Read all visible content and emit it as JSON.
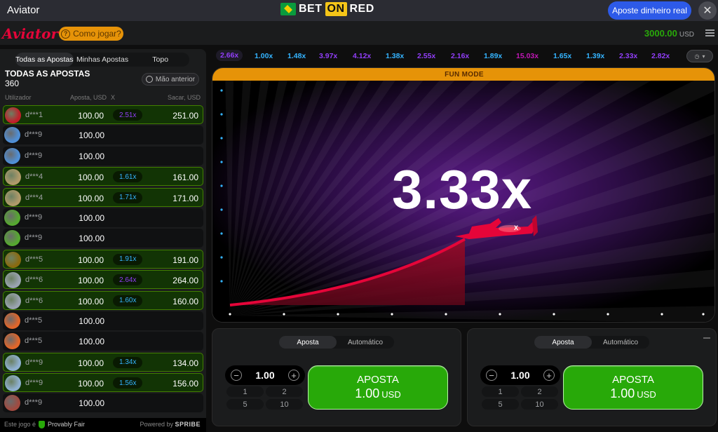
{
  "topbar": {
    "title": "Aviator",
    "brand": {
      "part1": "BET",
      "part2": "ON",
      "part3": "RED"
    },
    "real_money_label": "Aposte dinheiro real",
    "close_label": "✕"
  },
  "gamebar": {
    "logo": "Aviator",
    "how_to_play": "Como jogar?",
    "balance": "3000.00",
    "currency": "USD"
  },
  "bets_panel": {
    "tabs": [
      "Todas as Apostas",
      "Minhas Apostas",
      "Topo"
    ],
    "title": "TODAS AS APOSTAS",
    "count": "360",
    "previous_button": "Mão anterior",
    "columns": {
      "user": "Utilizador",
      "bet": "Aposta, USD",
      "x": "X",
      "cashout": "Sacar, USD"
    },
    "rows": [
      {
        "user": "d***1",
        "bet": "100.00",
        "mult": "2.51x",
        "cashout": "251.00",
        "win": true,
        "mult_color": "#913ef8",
        "avatar": "#c0202a"
      },
      {
        "user": "d***9",
        "bet": "100.00",
        "mult": "",
        "cashout": "",
        "win": false,
        "mult_color": "",
        "avatar": "#4f8fd6"
      },
      {
        "user": "d***9",
        "bet": "100.00",
        "mult": "",
        "cashout": "",
        "win": false,
        "mult_color": "",
        "avatar": "#4f8fd6"
      },
      {
        "user": "d***4",
        "bet": "100.00",
        "mult": "1.61x",
        "cashout": "161.00",
        "win": true,
        "mult_color": "#34b4ff",
        "avatar": "#b09a6a"
      },
      {
        "user": "d***4",
        "bet": "100.00",
        "mult": "1.71x",
        "cashout": "171.00",
        "win": true,
        "mult_color": "#34b4ff",
        "avatar": "#b09a6a"
      },
      {
        "user": "d***9",
        "bet": "100.00",
        "mult": "",
        "cashout": "",
        "win": false,
        "mult_color": "",
        "avatar": "#56a830"
      },
      {
        "user": "d***9",
        "bet": "100.00",
        "mult": "",
        "cashout": "",
        "win": false,
        "mult_color": "",
        "avatar": "#56a830"
      },
      {
        "user": "d***5",
        "bet": "100.00",
        "mult": "1.91x",
        "cashout": "191.00",
        "win": true,
        "mult_color": "#34b4ff",
        "avatar": "#8a6a10"
      },
      {
        "user": "d***6",
        "bet": "100.00",
        "mult": "2.64x",
        "cashout": "264.00",
        "win": true,
        "mult_color": "#913ef8",
        "avatar": "#9aa3b0"
      },
      {
        "user": "d***6",
        "bet": "100.00",
        "mult": "1.60x",
        "cashout": "160.00",
        "win": true,
        "mult_color": "#34b4ff",
        "avatar": "#9aa3b0"
      },
      {
        "user": "d***5",
        "bet": "100.00",
        "mult": "",
        "cashout": "",
        "win": false,
        "mult_color": "",
        "avatar": "#e0662a"
      },
      {
        "user": "d***5",
        "bet": "100.00",
        "mult": "",
        "cashout": "",
        "win": false,
        "mult_color": "",
        "avatar": "#e0662a"
      },
      {
        "user": "d***9",
        "bet": "100.00",
        "mult": "1.34x",
        "cashout": "134.00",
        "win": true,
        "mult_color": "#34b4ff",
        "avatar": "#8fb0d0"
      },
      {
        "user": "d***9",
        "bet": "100.00",
        "mult": "1.56x",
        "cashout": "156.00",
        "win": true,
        "mult_color": "#34b4ff",
        "avatar": "#8fb0d0"
      },
      {
        "user": "d***9",
        "bet": "100.00",
        "mult": "",
        "cashout": "",
        "win": false,
        "mult_color": "",
        "avatar": "#a04a40"
      }
    ]
  },
  "footer": {
    "provably_prefix": "Este jogo é",
    "provably_fair": "Provably Fair",
    "powered_by": "Powered by",
    "spribe": "SPRIBE"
  },
  "history": [
    {
      "value": "2.66x",
      "color": "#913ef8"
    },
    {
      "value": "1.00x",
      "color": "#34b4ff"
    },
    {
      "value": "1.48x",
      "color": "#34b4ff"
    },
    {
      "value": "3.97x",
      "color": "#913ef8"
    },
    {
      "value": "4.12x",
      "color": "#913ef8"
    },
    {
      "value": "1.38x",
      "color": "#34b4ff"
    },
    {
      "value": "2.55x",
      "color": "#913ef8"
    },
    {
      "value": "2.16x",
      "color": "#913ef8"
    },
    {
      "value": "1.89x",
      "color": "#34b4ff"
    },
    {
      "value": "15.03x",
      "color": "#c017b4"
    },
    {
      "value": "1.65x",
      "color": "#34b4ff"
    },
    {
      "value": "1.39x",
      "color": "#34b4ff"
    },
    {
      "value": "2.33x",
      "color": "#913ef8"
    },
    {
      "value": "2.82x",
      "color": "#913ef8"
    }
  ],
  "stage": {
    "fun_mode": "FUN MODE",
    "multiplier": "3.33x",
    "accent": "#e50539"
  },
  "bet_panels": [
    {
      "tabs": [
        "Aposta",
        "Automático"
      ],
      "amount": "1.00",
      "quick": [
        "1",
        "2",
        "5",
        "10"
      ],
      "button_label": "APOSTA",
      "button_amount": "1.00",
      "button_currency": "USD"
    },
    {
      "tabs": [
        "Aposta",
        "Automático"
      ],
      "amount": "1.00",
      "quick": [
        "1",
        "2",
        "5",
        "10"
      ],
      "button_label": "APOSTA",
      "button_amount": "1.00",
      "button_currency": "USD"
    }
  ]
}
